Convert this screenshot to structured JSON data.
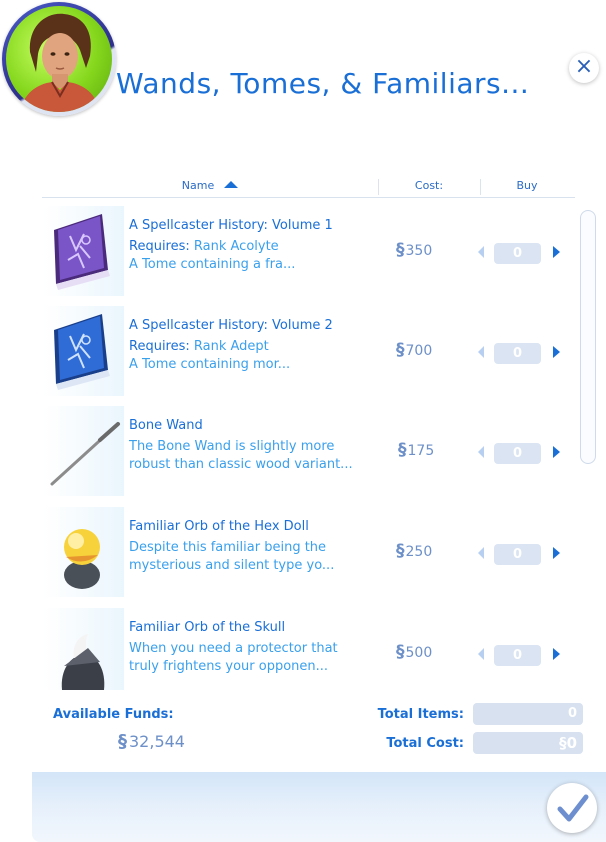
{
  "header": {
    "title": "Wands, Tomes, & Familiars...",
    "close_icon": "close-icon"
  },
  "columns": {
    "name": "Name",
    "cost": "Cost:",
    "buy": "Buy",
    "sort_direction": "ascending"
  },
  "items": [
    {
      "name": "A Spellcaster History: Volume 1",
      "line2_label": "Requires:",
      "line2_value": " Rank Acolyte",
      "line3": "A Tome containing a fra...",
      "price": "350",
      "quantity": "0",
      "icon": "purple-tome-icon"
    },
    {
      "name": "A Spellcaster History: Volume 2",
      "line2_label": "Requires:",
      "line2_value": " Rank Adept",
      "line3": "A Tome containing mor...",
      "price": "700",
      "quantity": "0",
      "icon": "blue-tome-icon"
    },
    {
      "name": "Bone Wand",
      "line2_label": "",
      "line2_value": "The Bone Wand is slightly more",
      "line3": "robust than classic wood variant...",
      "price": "175",
      "quantity": "0",
      "icon": "wand-icon"
    },
    {
      "name": "Familiar Orb of the Hex Doll",
      "line2_label": "",
      "line2_value": "Despite this familiar being the",
      "line3": "mysterious and silent type yo...",
      "price": "250",
      "quantity": "0",
      "icon": "orb-icon"
    },
    {
      "name": "Familiar Orb of the Skull",
      "line2_label": "",
      "line2_value": "When you need a protector that",
      "line3": "truly frightens your opponen...",
      "price": "500",
      "quantity": "0",
      "icon": "skull-orb-icon"
    }
  ],
  "currency_symbol": "§",
  "summary": {
    "funds_label": "Available Funds:",
    "funds_value": "32,544",
    "total_items_label": "Total Items:",
    "total_items_value": "0",
    "total_cost_label": "Total Cost:",
    "total_cost_value": "§0"
  },
  "colors": {
    "accent": "#1a6fd6",
    "secondary_text": "#3aa0ec",
    "price_text": "#6d90c9"
  }
}
